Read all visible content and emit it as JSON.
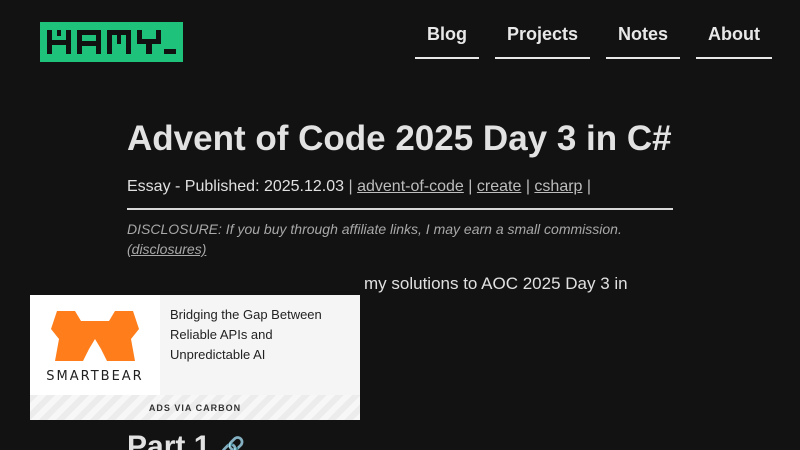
{
  "header": {
    "logo_text": "HAMY",
    "nav": [
      {
        "label": "Blog"
      },
      {
        "label": "Projects"
      },
      {
        "label": "Notes"
      },
      {
        "label": "About"
      }
    ]
  },
  "article": {
    "title": "Advent of Code 2025 Day 3 in C#",
    "meta_prefix": "Essay - Published: 2025.12.03",
    "sep": "|",
    "tags": [
      "advent-of-code",
      "create",
      "csharp"
    ],
    "disclosure_text": "DISCLOSURE: If you buy through affiliate links, I may earn a small commission.",
    "disclosure_link": "(disclosures)",
    "intro_visible": "my solutions to AOC 2025 Day 3 in",
    "section_heading": "Part 1",
    "section_link_icon": "link-icon"
  },
  "ad": {
    "brand": "SMARTBEAR",
    "text": "Bridging the Gap Between Reliable APIs and Unpredictable AI",
    "footer": "ADS VIA CARBON"
  },
  "colors": {
    "background": "#121212",
    "logo_bg": "#1ec27a",
    "brand_orange": "#ff7d1a"
  }
}
